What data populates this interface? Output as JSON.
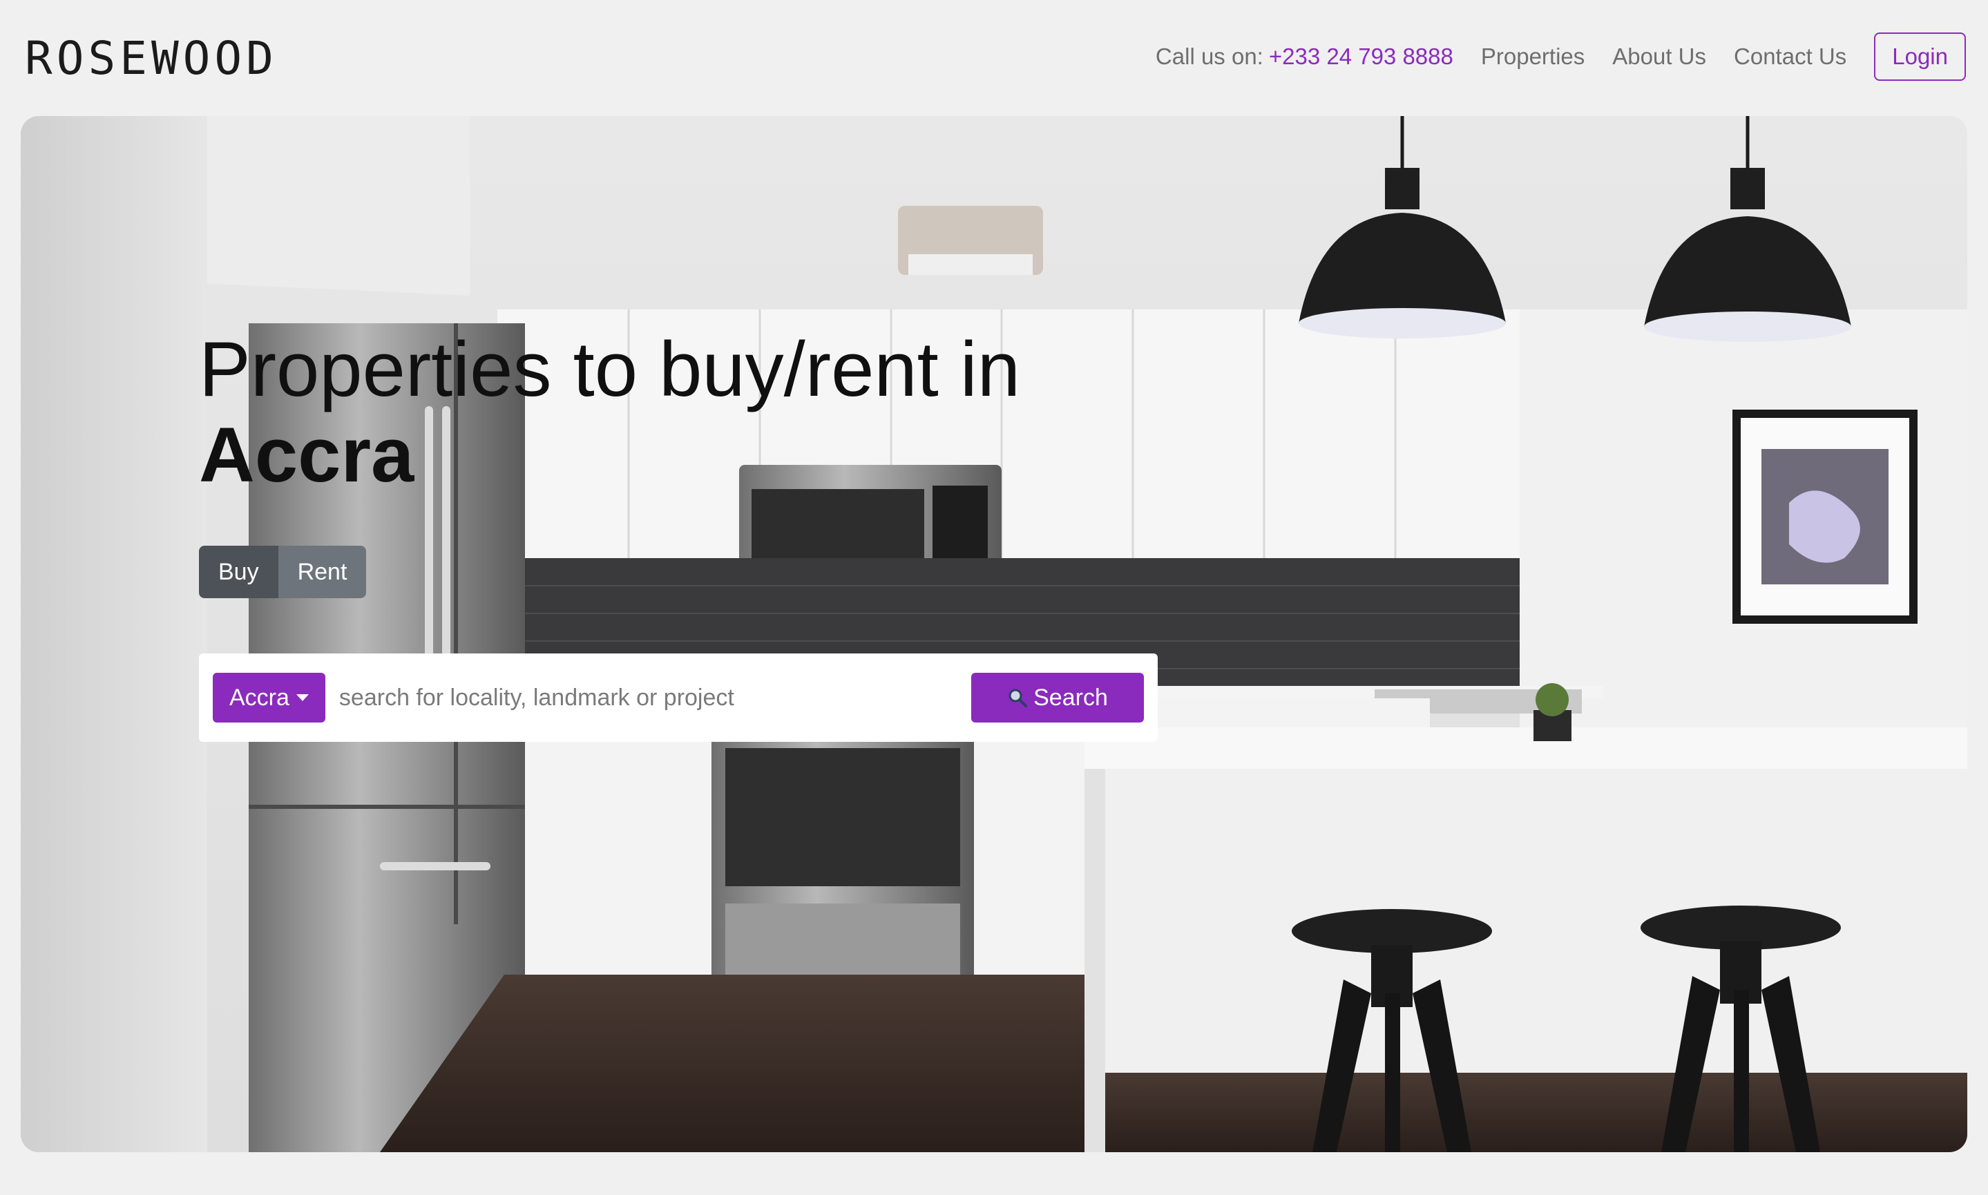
{
  "brand": {
    "logo": "ROSeWOOD"
  },
  "nav": {
    "call_label": "Call us on:",
    "phone": "+233 24 793 8888",
    "links": [
      "Properties",
      "About Us",
      "Contact Us"
    ],
    "login": "Login"
  },
  "hero": {
    "headline_light": "Properties to buy/rent in",
    "headline_city": "Accra",
    "tabs": [
      "Buy",
      "Rent"
    ],
    "search": {
      "city": "Accra",
      "placeholder": "search for locality, landmark or project",
      "button": "Search",
      "button_icon": "magnifier-icon"
    }
  },
  "colors": {
    "accent": "#8a2bbd",
    "tab_active": "#4c5258",
    "tab_inactive": "#6d747b",
    "page_bg": "#f0f0f0"
  }
}
